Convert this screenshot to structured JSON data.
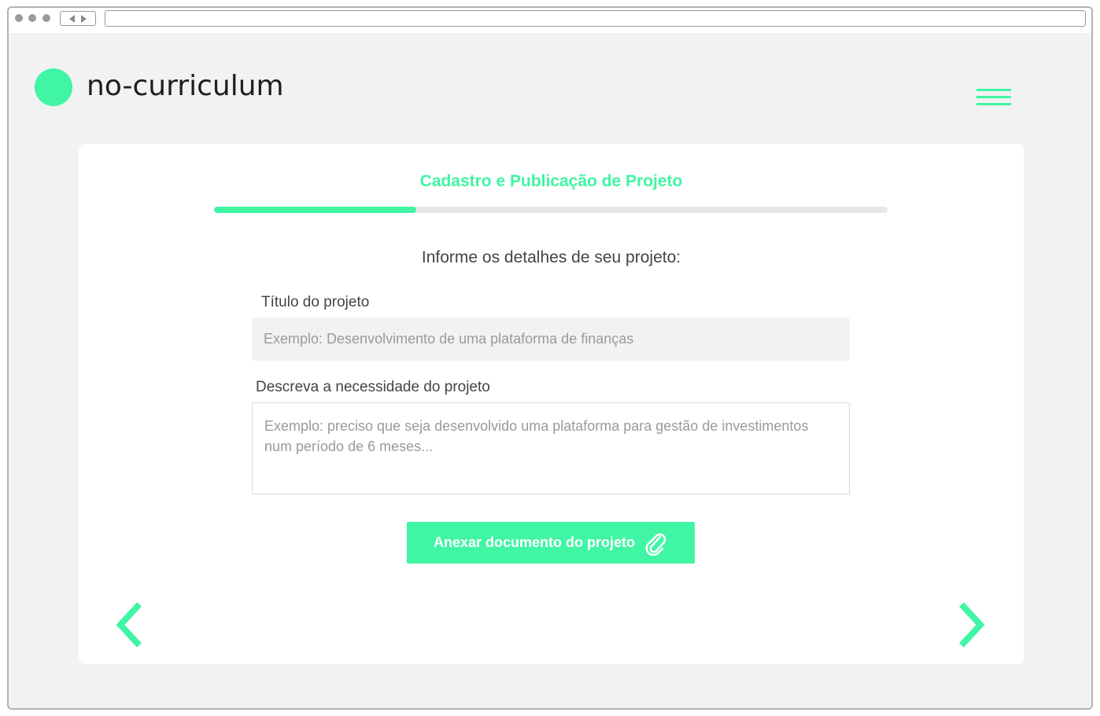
{
  "app": {
    "name": "no-curriculum"
  },
  "form": {
    "title": "Cadastro e Publicação de Projeto",
    "progress": 0.3,
    "subtitle": "Informe os detalhes de seu projeto:",
    "project_title": {
      "label": "Título do projeto",
      "value": "",
      "placeholder": "Exemplo: Desenvolvimento de uma plataforma de finanças"
    },
    "project_description": {
      "label": "Descreva a necessidade do projeto",
      "value": "",
      "placeholder": "Exemplo: preciso que seja desenvolvido uma plataforma para gestão de investimentos num período de 6 meses..."
    },
    "attach_button": {
      "label": "Anexar documento do projeto",
      "icon": "paperclip-icon"
    }
  },
  "colors": {
    "accent": "#40f5a3",
    "background": "#f2f2f2",
    "card": "#ffffff",
    "track": "#e6e7e8"
  },
  "icons": {
    "menu": "hamburger-menu-icon",
    "prev": "chevron-left-icon",
    "next": "chevron-right-icon"
  }
}
